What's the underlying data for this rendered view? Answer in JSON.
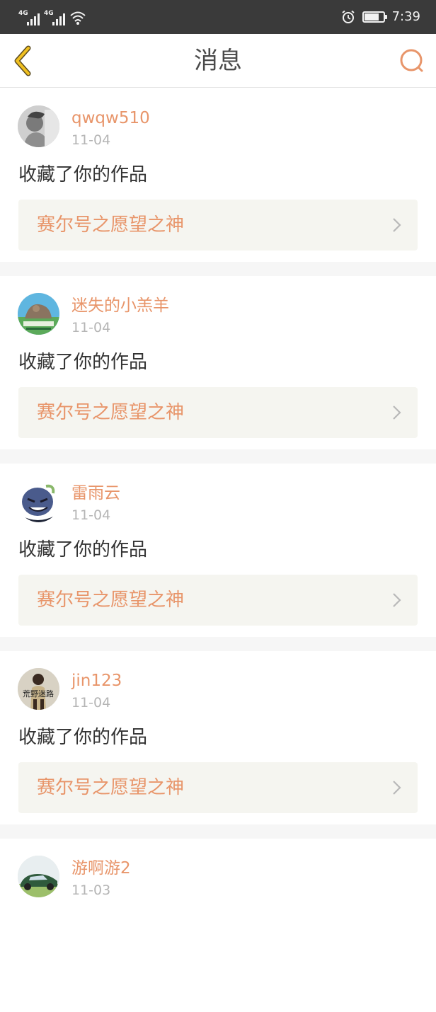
{
  "status_bar": {
    "signal1": "4G",
    "signal2": "4G",
    "battery_level": 0.75,
    "time": "7:39",
    "icons": [
      "signal-icon",
      "wifi-icon",
      "alarm-clock-icon",
      "battery-icon"
    ]
  },
  "nav": {
    "title": "消息",
    "back_icon": "chevron-left-icon",
    "search_icon": "search-icon",
    "accent_color": "#e8956a",
    "back_color": "#f0c020"
  },
  "notifications": [
    {
      "username": "qwqw510",
      "date": "11-04",
      "action": "收藏了你的作品",
      "work_title": "赛尔号之愿望之神",
      "avatar": "avatar-grayscale-photo"
    },
    {
      "username": "迷失的小羔羊",
      "date": "11-04",
      "action": "收藏了你的作品",
      "work_title": "赛尔号之愿望之神",
      "avatar": "avatar-cartoon-landscape"
    },
    {
      "username": "雷雨云",
      "date": "11-04",
      "action": "收藏了你的作品",
      "work_title": "赛尔号之愿望之神",
      "avatar": "avatar-cartoon-monster"
    },
    {
      "username": "jin123",
      "date": "11-04",
      "action": "收藏了你的作品",
      "work_title": "赛尔号之愿望之神",
      "avatar": "avatar-photo-with-text",
      "avatar_text": "荒野迷路"
    },
    {
      "username": "游啊游2",
      "date": "11-03",
      "action": "",
      "work_title": "",
      "avatar": "avatar-green-car"
    }
  ]
}
